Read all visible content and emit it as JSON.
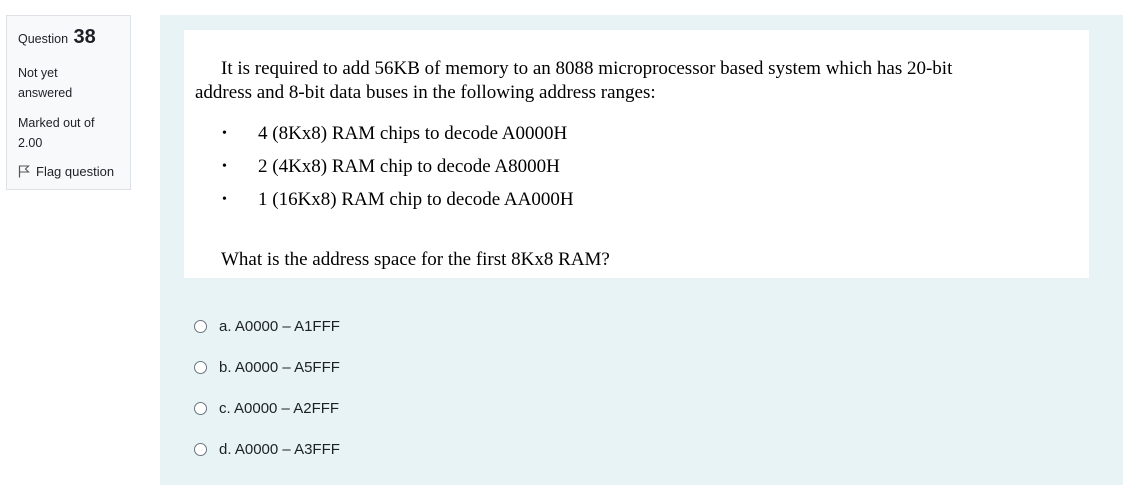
{
  "info": {
    "question_label": "Question",
    "question_number": "38",
    "state": "Not yet answered",
    "state_line1": "Not yet",
    "state_line2": "answered",
    "grade_line1": "Marked out of",
    "grade_line2": "2.00",
    "flag_label": "Flag question"
  },
  "question": {
    "line1": "It is required to add 56KB of memory to an 8088 microprocessor based system which has 20-bit",
    "line2": "address and 8-bit data buses in the following address ranges:",
    "bullets": [
      "4 (8Kx8) RAM chips to decode A0000H",
      "2 (4Kx8) RAM chip to decode A8000H",
      "1 (16Kx8) RAM chip to decode AA000H"
    ],
    "prompt": "What is the address space for the first 8Kx8 RAM?"
  },
  "answers": [
    "a. A0000 – A1FFF",
    "b. A0000 – A5FFF",
    "c. A0000 – A2FFF",
    "d. A0000 – A3FFF"
  ],
  "icons": {
    "flag": "flag-icon",
    "bullet": "bullet-dot"
  }
}
